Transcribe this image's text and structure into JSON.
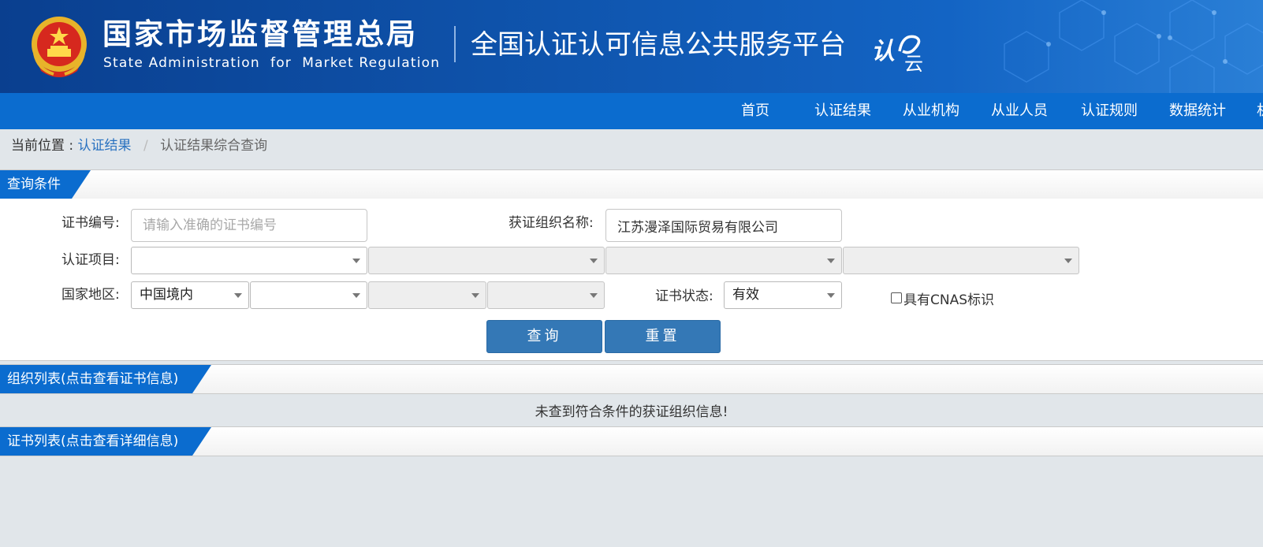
{
  "header": {
    "org_name_cn": "国家市场监督管理总局",
    "org_name_en": "State Administration  for  Market Regulation",
    "platform_title": "全国认证认可信息公共服务平台",
    "logo_text": "认云"
  },
  "nav": {
    "items": [
      "首页",
      "认证结果",
      "从业机构",
      "从业人员",
      "认证规则",
      "数据统计",
      "机"
    ]
  },
  "breadcrumb": {
    "label": "当前位置 :",
    "link": "认证结果",
    "separator": "/",
    "current": "认证结果综合查询"
  },
  "query_section": {
    "title": "查询条件",
    "cert_no_label": "证书编号:",
    "cert_no_placeholder": "请输入准确的证书编号",
    "cert_no_value": "",
    "org_name_label": "获证组织名称:",
    "org_name_value": "江苏漫泽国际贸易有限公司",
    "project_label": "认证项目:",
    "project_selects": [
      "",
      "",
      "",
      ""
    ],
    "region_label": "国家地区:",
    "region_selects": [
      "中国境内",
      "",
      "",
      ""
    ],
    "status_label": "证书状态:",
    "status_value": "有效",
    "cnas_label": "具有CNAS标识",
    "query_button": "查询",
    "reset_button": "重置"
  },
  "org_list": {
    "title": "组织列表(点击查看证书信息)",
    "empty_message": "未查到符合条件的获证组织信息!"
  },
  "cert_list": {
    "title": "证书列表(点击查看详细信息)"
  },
  "colors": {
    "nav_blue": "#0b6ccf",
    "button_blue": "#3478b6",
    "page_bg": "#e1e6ea"
  }
}
